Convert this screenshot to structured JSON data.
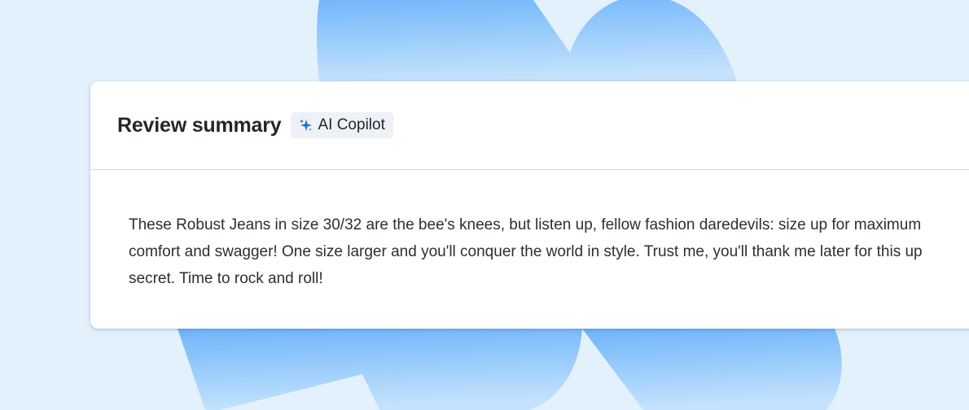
{
  "card": {
    "title": "Review summary",
    "badge": {
      "icon": "sparkle-icon",
      "label": "AI Copilot"
    },
    "summary": "These Robust Jeans in size 30/32 are the bee's knees, but listen up, fellow fashion daredevils: size up for maximum comfort and swagger! One size larger and you'll conquer the world in style. Trust me, you'll thank me later for this up secret. Time to rock and roll!"
  },
  "colors": {
    "page_background": "#e3f1fd",
    "decor_blue": "#7fbcfb",
    "card_background": "#ffffff",
    "sparkle_blue": "#1e6fe0"
  }
}
